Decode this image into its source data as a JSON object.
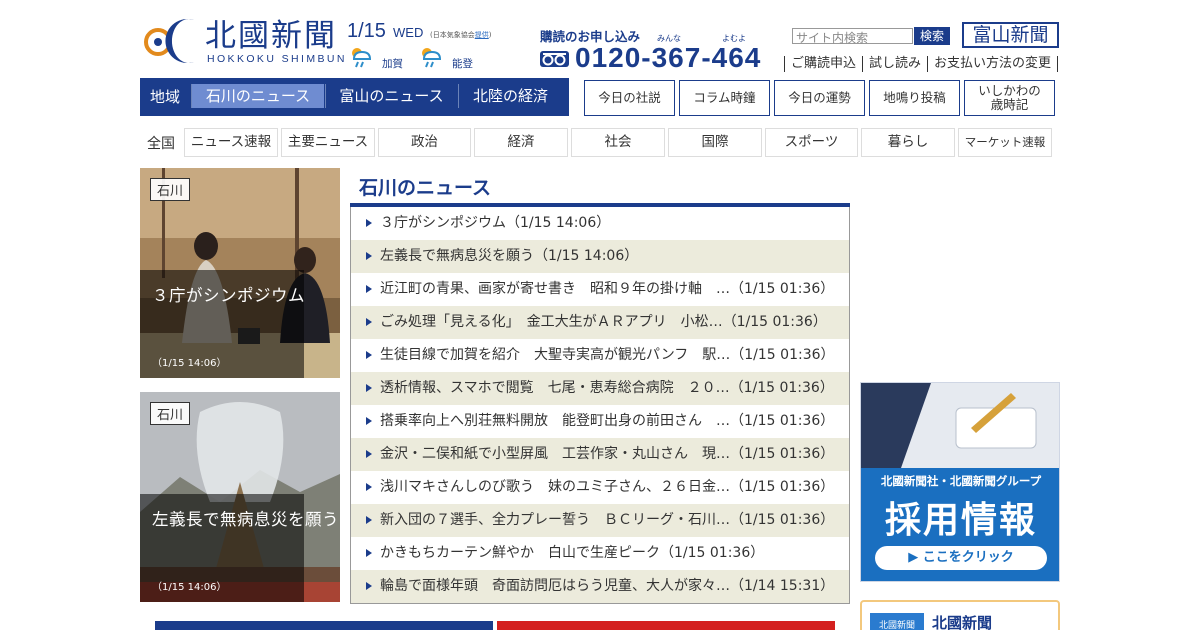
{
  "header": {
    "logo_text": "北國新聞",
    "logo_sub": "HOKKOKU SHIMBUN",
    "date": "1/15",
    "weekday": "WED",
    "weather_note": "(日本気象協会",
    "weather_note_link": "提供",
    "weather_note_end": ")",
    "weather": [
      {
        "area": "加賀",
        "icon": "rain-sun-icon"
      },
      {
        "area": "能登",
        "icon": "rain-sun-icon"
      }
    ],
    "subscribe_label": "購読のお申し込み",
    "ruby_1": "みんな",
    "ruby_2": "よむよ",
    "phone": "0120-367-464",
    "search_placeholder": "サイト内検索",
    "search_button": "検索",
    "toyama_button": "富山新聞",
    "top_links": [
      "ご購読申込",
      "試し読み",
      "お支払い方法の変更"
    ]
  },
  "nav": {
    "label": "地域",
    "tabs": [
      "石川のニュース",
      "富山のニュース",
      "北陸の経済"
    ],
    "active_tab": 0,
    "boxes": [
      "今日の社説",
      "コラム時鐘",
      "今日の運勢",
      "地鳴り投稿",
      "いしかわの\n歳時記"
    ]
  },
  "categories": {
    "all_label": "全国",
    "items": [
      "ニュース速報",
      "主要ニュース",
      "政治",
      "経済",
      "社会",
      "国際",
      "スポーツ",
      "暮らし",
      "マーケット速報"
    ]
  },
  "features": [
    {
      "tag": "石川",
      "title": "３庁がシンポジウム",
      "time": "（1/15 14:06）"
    },
    {
      "tag": "石川",
      "title": "左義長で無病息災を願う",
      "time": "（1/15 14:06）"
    }
  ],
  "news": {
    "heading": "石川のニュース",
    "items": [
      "３庁がシンポジウム（1/15 14:06）",
      "左義長で無病息災を願う（1/15 14:06）",
      "近江町の青果、画家が寄せ書き　昭和９年の掛け軸　…（1/15 01:36）",
      "ごみ処理「見える化」　金工大生がＡＲアプリ　小松…（1/15 01:36）",
      "生徒目線で加賀を紹介　大聖寺実高が観光パンフ　駅…（1/15 01:36）",
      "透析情報、スマホで閲覧　七尾・恵寿総合病院　２０…（1/15 01:36）",
      "搭乗率向上へ別荘無料開放　能登町出身の前田さん　…（1/15 01:36）",
      "金沢・二俣和紙で小型屏風　工芸作家・丸山さん　現…（1/15 01:36）",
      "浅川マキさんしのび歌う　妹のユミ子さん、２６日金…（1/15 01:36）",
      "新入団の７選手、全力プレー誓う　ＢＣリーグ・石川…（1/15 01:36）",
      "かきもちカーテン鮮やか　白山で生産ピーク（1/15 01:36）",
      "輪島で面様年頭　奇面訪問厄はらう児童、大人が家々…（1/14 15:31）"
    ]
  },
  "ad": {
    "line1": "北國新聞社・北國新聞グループ",
    "line2": "採用情報",
    "button": "▶ ここをクリック"
  },
  "ad2": {
    "title": "北國新聞",
    "badge": "北國新聞"
  },
  "colors": {
    "brand": "#1b3c8b",
    "active_tab": "#6f8cd1",
    "row_alt": "#ecebdc"
  }
}
